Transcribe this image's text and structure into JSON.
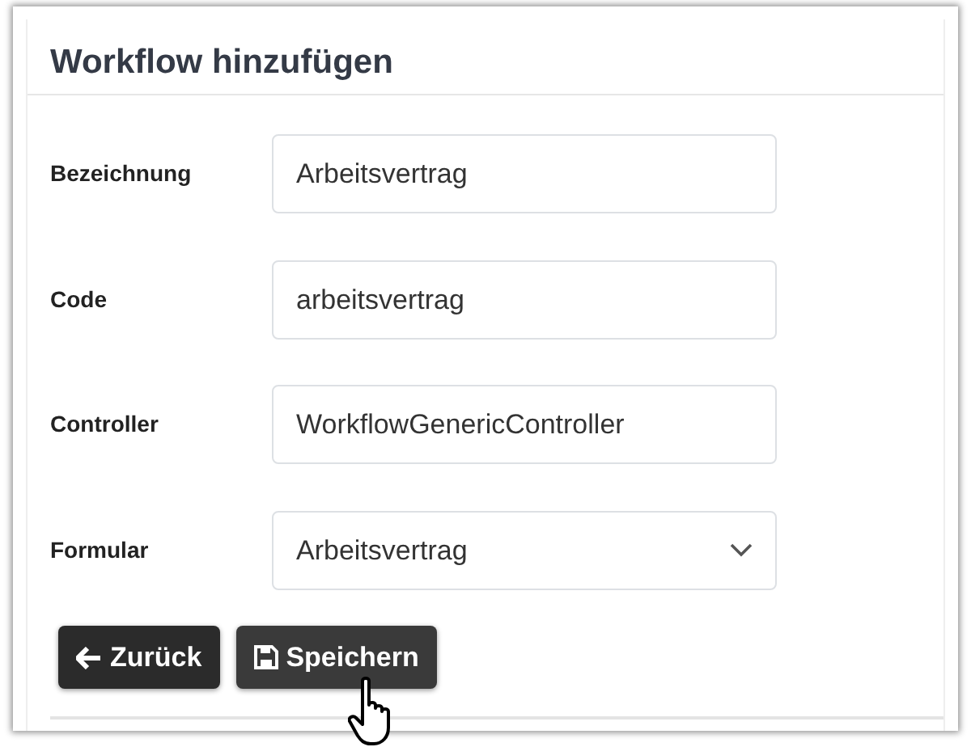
{
  "title": "Workflow hinzufügen",
  "fields": [
    {
      "label": "Bezeichnung",
      "kind": "text",
      "value": "Arbeitsvertrag"
    },
    {
      "label": "Code",
      "kind": "text",
      "value": "arbeitsvertrag"
    },
    {
      "label": "Controller",
      "kind": "text",
      "value": "WorkflowGenericController"
    },
    {
      "label": "Formular",
      "kind": "select",
      "value": "Arbeitsvertrag"
    }
  ],
  "buttons": [
    {
      "label": "Zurück",
      "kind": "back"
    },
    {
      "label": "Speichern",
      "kind": "save"
    }
  ]
}
